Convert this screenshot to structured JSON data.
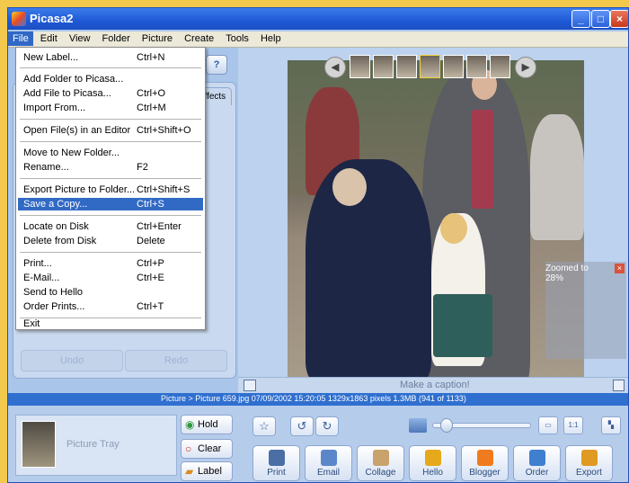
{
  "window": {
    "title": "Picasa2"
  },
  "menubar": {
    "items": [
      "File",
      "Edit",
      "View",
      "Folder",
      "Picture",
      "Create",
      "Tools",
      "Help"
    ]
  },
  "file_menu": {
    "items": [
      {
        "label": "New Label...",
        "shortcut": "Ctrl+N"
      },
      {
        "label": "Add Folder to Picasa...",
        "shortcut": ""
      },
      {
        "label": "Add File to Picasa...",
        "shortcut": "Ctrl+O"
      },
      {
        "label": "Import From...",
        "shortcut": "Ctrl+M"
      },
      {
        "label": "Open File(s) in an Editor",
        "shortcut": "Ctrl+Shift+O"
      },
      {
        "label": "Move to New Folder...",
        "shortcut": ""
      },
      {
        "label": "Rename...",
        "shortcut": "F2"
      },
      {
        "label": "Export Picture to Folder...",
        "shortcut": "Ctrl+Shift+S"
      },
      {
        "label": "Save a Copy...",
        "shortcut": "Ctrl+S"
      },
      {
        "label": "Locate on Disk",
        "shortcut": "Ctrl+Enter"
      },
      {
        "label": "Delete from Disk",
        "shortcut": "Delete"
      },
      {
        "label": "Print...",
        "shortcut": "Ctrl+P"
      },
      {
        "label": "E-Mail...",
        "shortcut": "Ctrl+E"
      },
      {
        "label": "Send to Hello",
        "shortcut": ""
      },
      {
        "label": "Order Prints...",
        "shortcut": "Ctrl+T"
      },
      {
        "label": "Exit",
        "shortcut": ""
      }
    ],
    "highlighted": "Save a Copy..."
  },
  "left_panel": {
    "effects_tab": "Effects",
    "undo": "Undo",
    "redo": "Redo"
  },
  "viewer": {
    "caption_placeholder": "Make a caption!",
    "zoom_label": "Zoomed to 28%"
  },
  "status": {
    "text": "Picture > Picture 659.jpg   07/09/2002 15:20:05   1329x1863 pixels   1.3MB   (941 of 1133)"
  },
  "tray": {
    "label": "Picture Tray",
    "hold": "Hold",
    "clear": "Clear",
    "label_btn": "Label"
  },
  "view_buttons": {
    "one_to_one": "1:1"
  },
  "actions": [
    {
      "label": "Print",
      "color": "#4a6fa5"
    },
    {
      "label": "Email",
      "color": "#5b86c9"
    },
    {
      "label": "Collage",
      "color": "#c9a36b"
    },
    {
      "label": "Hello",
      "color": "#e7a91c"
    },
    {
      "label": "Blogger",
      "color": "#f07b1e"
    },
    {
      "label": "Order",
      "color": "#3e7fd0"
    },
    {
      "label": "Export",
      "color": "#e09a22"
    }
  ]
}
